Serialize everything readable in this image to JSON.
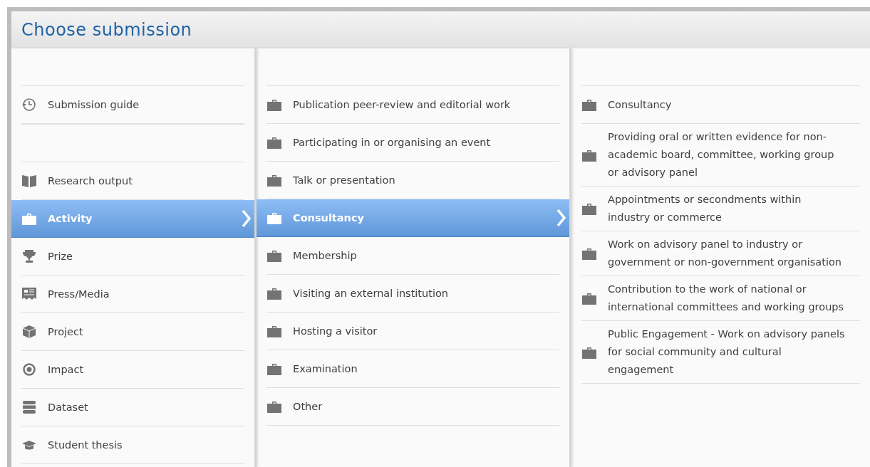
{
  "window": {
    "title": "Choose submission"
  },
  "columns": [
    {
      "groups": [
        [
          {
            "kind": "guide",
            "label": "Submission guide",
            "selected": false
          }
        ],
        [
          {
            "kind": "book",
            "label": "Research output",
            "selected": false
          },
          {
            "kind": "briefcase",
            "label": "Activity",
            "selected": true
          },
          {
            "kind": "trophy",
            "label": "Prize",
            "selected": false
          },
          {
            "kind": "press",
            "label": "Press/Media",
            "selected": false
          },
          {
            "kind": "cube",
            "label": "Project",
            "selected": false
          },
          {
            "kind": "target",
            "label": "Impact",
            "selected": false
          },
          {
            "kind": "database",
            "label": "Dataset",
            "selected": false
          },
          {
            "kind": "cap",
            "label": "Student thesis",
            "selected": false
          }
        ]
      ]
    },
    {
      "groups": [
        [
          {
            "kind": "briefcase",
            "label": "Publication peer-review and editorial work",
            "selected": false
          },
          {
            "kind": "briefcase",
            "label": "Participating in or organising an event",
            "selected": false
          },
          {
            "kind": "briefcase",
            "label": "Talk or presentation",
            "selected": false
          },
          {
            "kind": "briefcase",
            "label": "Consultancy",
            "selected": true
          },
          {
            "kind": "briefcase",
            "label": "Membership",
            "selected": false
          },
          {
            "kind": "briefcase",
            "label": "Visiting an external institution",
            "selected": false
          },
          {
            "kind": "briefcase",
            "label": "Hosting a visitor",
            "selected": false
          },
          {
            "kind": "briefcase",
            "label": "Examination",
            "selected": false
          },
          {
            "kind": "briefcase",
            "label": "Other",
            "selected": false
          }
        ]
      ]
    },
    {
      "groups": [
        [
          {
            "kind": "briefcase",
            "label": "Consultancy",
            "selected": false
          },
          {
            "kind": "briefcase",
            "label": "Providing oral or written evidence for non-academic board, committee, working group or advisory panel",
            "selected": false
          },
          {
            "kind": "briefcase",
            "label": "Appointments or secondments within industry or commerce",
            "selected": false
          },
          {
            "kind": "briefcase",
            "label": "Work on advisory panel to industry or government or non-government organisation",
            "selected": false
          },
          {
            "kind": "briefcase",
            "label": "Contribution to the work of national or international committees and working groups",
            "selected": false
          },
          {
            "kind": "briefcase",
            "label": "Public Engagement - Work on advisory panels for social community and cultural engagement",
            "selected": false
          }
        ]
      ]
    }
  ]
}
